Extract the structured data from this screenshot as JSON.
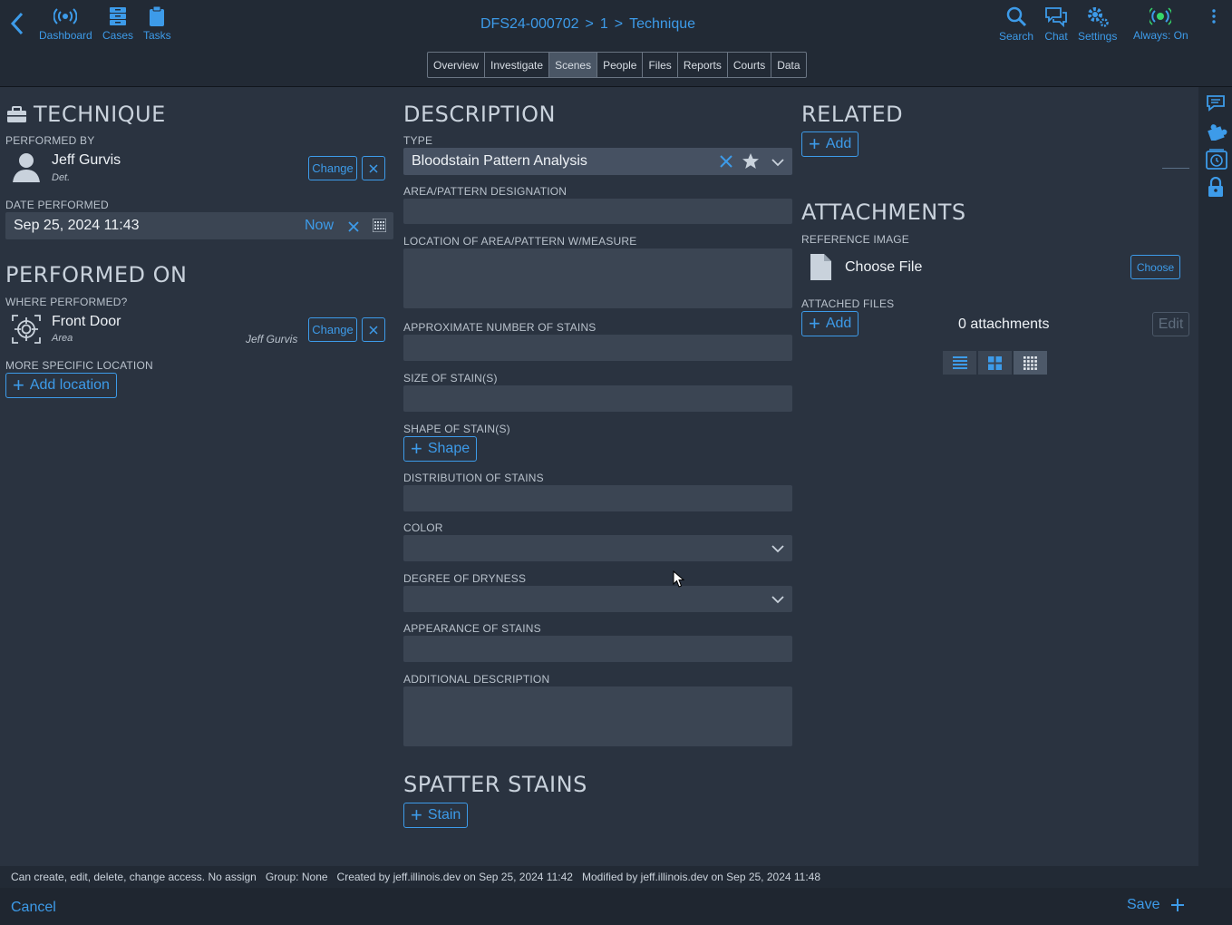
{
  "header": {
    "breadcrumb": [
      "DFS24-000702",
      ">",
      "1",
      ">",
      "Technique"
    ],
    "nav": [
      {
        "label": "Dashboard",
        "icon": "broadcast-icon"
      },
      {
        "label": "Cases",
        "icon": "cabinet-icon"
      },
      {
        "label": "Tasks",
        "icon": "clipboard-icon"
      }
    ],
    "tools": [
      {
        "label": "Search",
        "icon": "search-icon"
      },
      {
        "label": "Chat",
        "icon": "chat-icon"
      },
      {
        "label": "Settings",
        "icon": "gear-icon"
      },
      {
        "label": "Always: On",
        "icon": "signal-icon"
      }
    ],
    "tabs": [
      "Overview",
      "Investigate",
      "Scenes",
      "People",
      "Files",
      "Reports",
      "Courts",
      "Data"
    ],
    "active_tab": "Scenes"
  },
  "technique": {
    "title": "TECHNIQUE",
    "performed_by_label": "PERFORMED BY",
    "person_name": "Jeff Gurvis",
    "person_role": "Det.",
    "change_label": "Change",
    "date_label": "DATE PERFORMED",
    "date_value": "Sep 25, 2024 11:43",
    "now_label": "Now"
  },
  "performed_on": {
    "title": "PERFORMED ON",
    "where_label": "WHERE PERFORMED?",
    "place_name": "Front Door",
    "place_type": "Area",
    "place_by": "Jeff Gurvis",
    "change_label": "Change",
    "more_location_label": "MORE SPECIFIC LOCATION",
    "add_location_label": "Add location"
  },
  "description": {
    "title": "DESCRIPTION",
    "type_label": "TYPE",
    "type_value": "Bloodstain Pattern Analysis",
    "fields": {
      "area": "AREA/PATTERN DESIGNATION",
      "location": "LOCATION OF AREA/PATTERN W/MEASURE",
      "approx": "APPROXIMATE NUMBER OF STAINS",
      "size": "SIZE OF STAIN(S)",
      "shape": "SHAPE OF STAIN(S)",
      "distribution": "DISTRIBUTION OF STAINS",
      "color": "COLOR",
      "dryness": "DEGREE OF DRYNESS",
      "appearance": "APPEARANCE OF STAINS",
      "additional": "ADDITIONAL DESCRIPTION"
    },
    "shape_button": "Shape",
    "spatter_title": "SPATTER STAINS",
    "stain_button": "Stain"
  },
  "related": {
    "title": "RELATED",
    "add_label": "Add"
  },
  "attachments": {
    "title": "ATTACHMENTS",
    "reference_label": "REFERENCE IMAGE",
    "choose_file_label": "Choose File",
    "choose_button": "Choose",
    "attached_label": "ATTACHED FILES",
    "add_label": "Add",
    "count_text": "0 attachments",
    "edit_label": "Edit"
  },
  "status": {
    "access": "Can create, edit, delete, change access. No assign",
    "group": "Group: None",
    "created": "Created by jeff.illinois.dev on Sep 25, 2024 11:42",
    "modified": "Modified by jeff.illinois.dev on Sep 25, 2024 11:48"
  },
  "footer": {
    "cancel": "Cancel",
    "save": "Save"
  },
  "colors": {
    "accent": "#3d9be9",
    "background": "#2a3340",
    "bar": "#222a35",
    "field": "#3b4553"
  }
}
